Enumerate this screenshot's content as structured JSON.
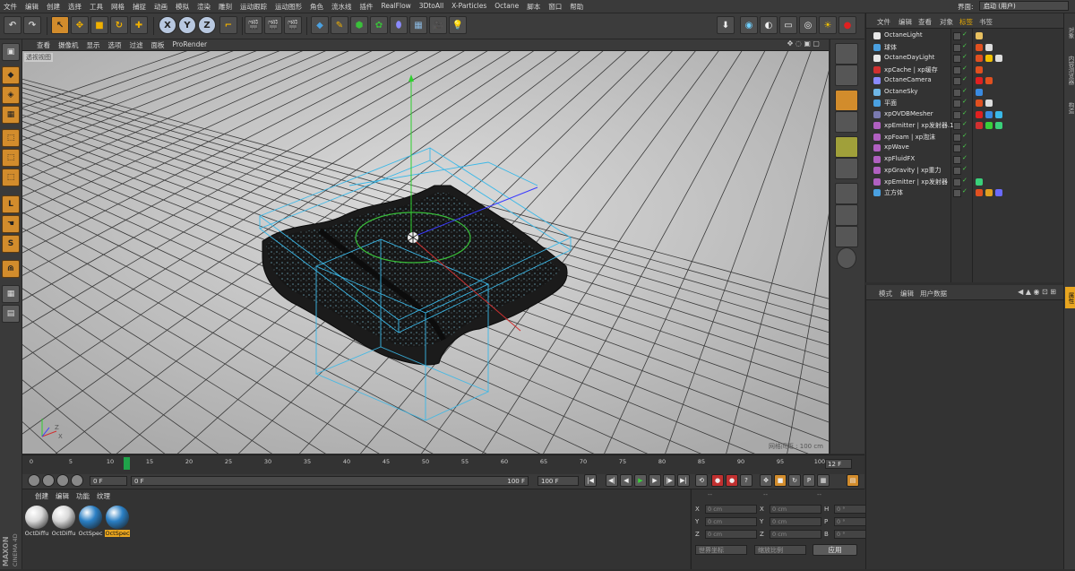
{
  "menubar": {
    "items": [
      "文件",
      "编辑",
      "创建",
      "选择",
      "工具",
      "网格",
      "捕捉",
      "动画",
      "模拟",
      "渲染",
      "雕刻",
      "运动跟踪",
      "运动图形",
      "角色",
      "流水线",
      "插件",
      "RealFlow",
      "3DtoAll",
      "X-Particles",
      "Octane",
      "脚本",
      "窗口",
      "帮助"
    ],
    "layout_label": "界面:",
    "layout_value": "启动 (用户)"
  },
  "toolbar": {
    "axis_x": "X",
    "axis_y": "Y",
    "axis_z": "Z"
  },
  "viewport": {
    "menu": [
      "查看",
      "摄像机",
      "显示",
      "选项",
      "过滤",
      "面板",
      "ProRender"
    ],
    "label": "透视视图",
    "grid_spacing": "网格间距 : 100 cm",
    "colors": {
      "bg": "#c9c9c9",
      "grid": "#3a3a3a",
      "wire": "#3ab8e8",
      "mesh": "#1a1a1a"
    }
  },
  "timeline": {
    "ticks": [
      "0",
      "5",
      "10",
      "15",
      "20",
      "25",
      "30",
      "35",
      "40",
      "45",
      "50",
      "55",
      "60",
      "65",
      "70",
      "75",
      "80",
      "85",
      "90",
      "95",
      "100"
    ],
    "current_frame": "12",
    "frame_box": "12 F"
  },
  "transport": {
    "start": "0 F",
    "range_start": "0 F",
    "range_end": "100 F",
    "end": "100 F"
  },
  "materials": {
    "tabs": [
      "创建",
      "编辑",
      "功能",
      "纹理"
    ],
    "items": [
      {
        "name": "OctDiffu",
        "color": "#d8d8d8",
        "selected": false
      },
      {
        "name": "OctDiffu",
        "color": "#d8d8d8",
        "selected": false
      },
      {
        "name": "OctSpec",
        "color": "#2a7fc4",
        "selected": false
      },
      {
        "name": "OctSpec",
        "color": "#2a7fc4",
        "selected": true
      }
    ]
  },
  "branding": {
    "maxon": "MAXON",
    "cinema": "CINEMA 4D"
  },
  "coords": {
    "headers": [
      "--",
      "--",
      "--"
    ],
    "rows": [
      {
        "a1": "X",
        "v1": "0 cm",
        "a2": "X",
        "v2": "0 cm",
        "a3": "H",
        "v3": "0 °"
      },
      {
        "a1": "Y",
        "v1": "0 cm",
        "a2": "Y",
        "v2": "0 cm",
        "a3": "P",
        "v3": "0 °"
      },
      {
        "a1": "Z",
        "v1": "0 cm",
        "a2": "Z",
        "v2": "0 cm",
        "a3": "B",
        "v3": "0 °"
      }
    ],
    "space": "世界坐标",
    "scale": "缩放比例",
    "apply": "应用"
  },
  "object_manager": {
    "tabs": [
      "文件",
      "编辑",
      "查看",
      "对象",
      "标签",
      "书签"
    ],
    "objects": [
      {
        "name": "OctaneLight",
        "icon": "#e8e8e8"
      },
      {
        "name": "球体",
        "icon": "#4aa0e0"
      },
      {
        "name": "OctaneDayLight",
        "icon": "#e8e8e8"
      },
      {
        "name": "xpCache | xp缓存",
        "icon": "#d03030"
      },
      {
        "name": "OctaneCamera",
        "icon": "#8a8aff"
      },
      {
        "name": "OctaneSky",
        "icon": "#6fb6e6"
      },
      {
        "name": "平面",
        "icon": "#4aa0e0"
      },
      {
        "name": "xpOVDBMesher",
        "icon": "#7a7ab0"
      },
      {
        "name": "xpEmitter | xp发射器.1",
        "icon": "#b060c0"
      },
      {
        "name": "xpFoam | xp泡沫",
        "icon": "#b060c0"
      },
      {
        "name": "xpWave",
        "icon": "#b060c0"
      },
      {
        "name": "xpFluidFX",
        "icon": "#b060c0"
      },
      {
        "name": "xpGravity | xp重力",
        "icon": "#b060c0"
      },
      {
        "name": "xpEmitter | xp发射器",
        "icon": "#b060c0"
      },
      {
        "name": "立方体",
        "icon": "#4aa0e0"
      }
    ]
  },
  "attribute_manager": {
    "tabs": [
      "模式",
      "编辑",
      "用户数据"
    ]
  },
  "right_strip": [
    "对象",
    "内容浏览器",
    "构造",
    "属性"
  ]
}
